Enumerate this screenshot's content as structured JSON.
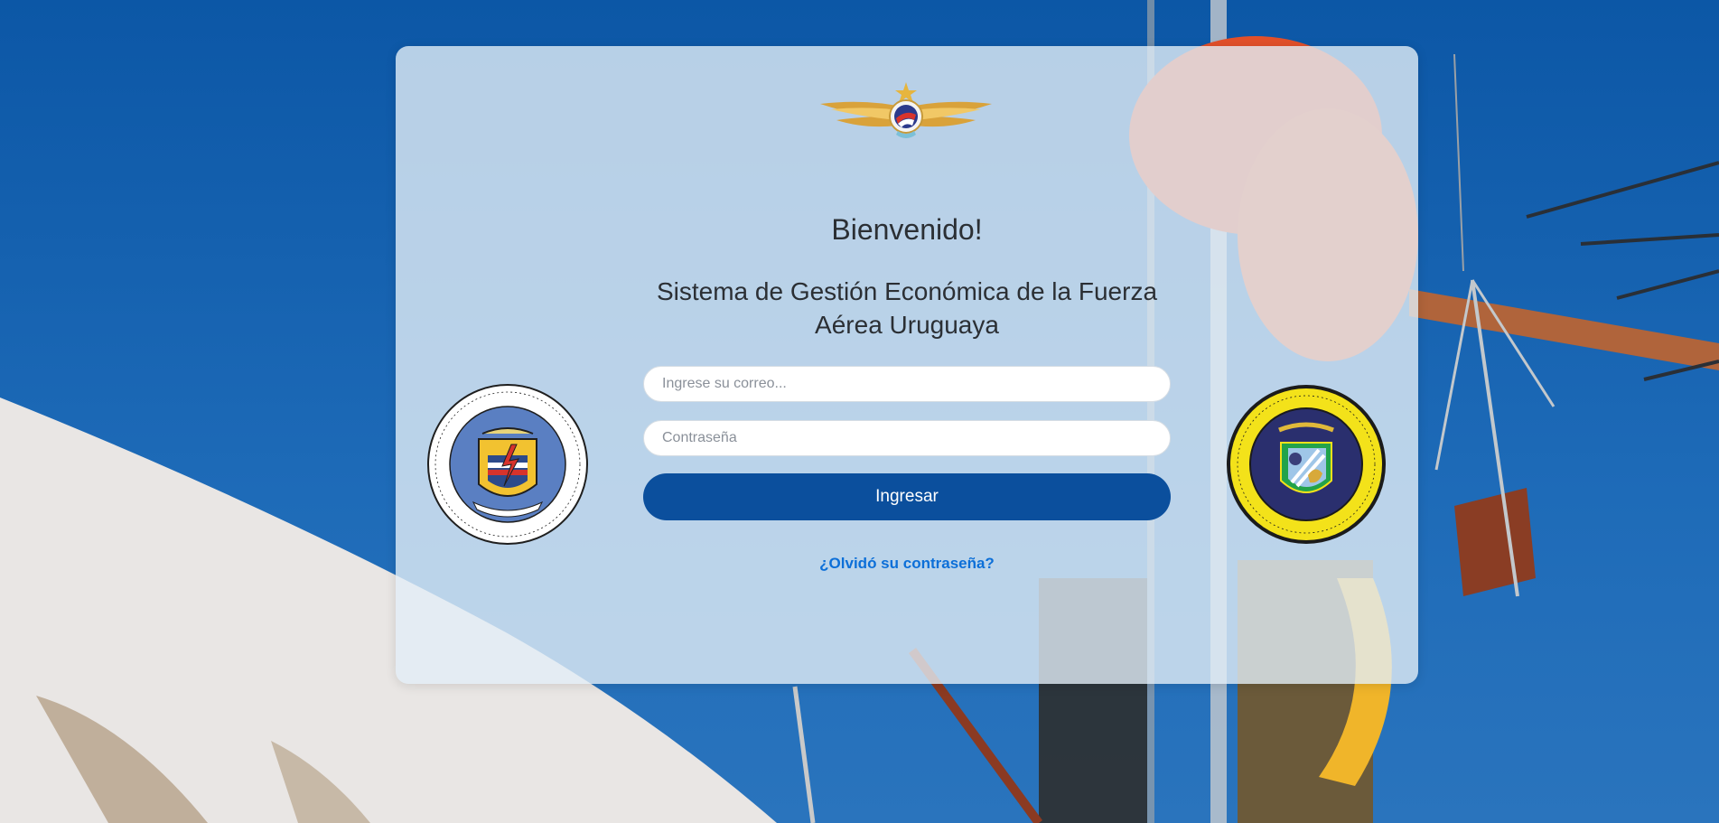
{
  "header": {
    "welcome": "Bienvenido!",
    "system_title": "Sistema de Gestión Económica de la Fuerza Aérea Uruguaya"
  },
  "form": {
    "email_placeholder": "Ingrese su correo...",
    "password_placeholder": "Contraseña",
    "email_value": "",
    "password_value": "",
    "submit_label": "Ingresar",
    "forgot_label": "¿Olvidó su contraseña?"
  },
  "emblems": {
    "top": "winged-insignia-icon",
    "left": "comunicaciones-informatica-emblem",
    "right": "economia-finanzas-emblem"
  },
  "colors": {
    "accent": "#0b4f9d",
    "link": "#0c6fd8",
    "background": "#1d5fa8"
  }
}
